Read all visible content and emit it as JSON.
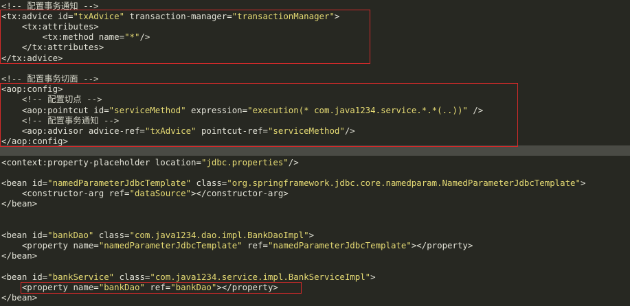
{
  "lines": [
    {
      "segments": [
        {
          "t": "<!-- ",
          "k": "c"
        },
        {
          "t": "配置事务通知",
          "k": "c"
        },
        {
          "t": " -->",
          "k": "c"
        }
      ]
    },
    {
      "segments": [
        {
          "t": "<tx:advice ",
          "k": "tag"
        },
        {
          "t": "id=",
          "k": "attr"
        },
        {
          "t": "\"txAdvice\"",
          "k": "str"
        },
        {
          "t": " transaction-manager=",
          "k": "attr"
        },
        {
          "t": "\"transactionManager\"",
          "k": "str"
        },
        {
          "t": ">",
          "k": "tag"
        }
      ]
    },
    {
      "segments": [
        {
          "t": "    <tx:attributes>",
          "k": "tag"
        }
      ]
    },
    {
      "segments": [
        {
          "t": "        <tx:method ",
          "k": "tag"
        },
        {
          "t": "name=",
          "k": "attr"
        },
        {
          "t": "\"*\"",
          "k": "str"
        },
        {
          "t": "/>",
          "k": "tag"
        }
      ]
    },
    {
      "segments": [
        {
          "t": "    </tx:attributes>",
          "k": "tag"
        }
      ]
    },
    {
      "segments": [
        {
          "t": "</tx:advice>",
          "k": "tag"
        }
      ]
    },
    {
      "segments": []
    },
    {
      "segments": [
        {
          "t": "<!-- ",
          "k": "c"
        },
        {
          "t": "配置事务切面",
          "k": "c"
        },
        {
          "t": " -->",
          "k": "c"
        }
      ]
    },
    {
      "segments": [
        {
          "t": "<aop:config>",
          "k": "tag"
        }
      ]
    },
    {
      "segments": [
        {
          "t": "    <!-- ",
          "k": "c"
        },
        {
          "t": "配置切点",
          "k": "c"
        },
        {
          "t": " -->",
          "k": "c"
        }
      ]
    },
    {
      "segments": [
        {
          "t": "    <aop:pointcut ",
          "k": "tag"
        },
        {
          "t": "id=",
          "k": "attr"
        },
        {
          "t": "\"serviceMethod\"",
          "k": "str"
        },
        {
          "t": " expression=",
          "k": "attr"
        },
        {
          "t": "\"execution(* com.java1234.service.*.*(..))\"",
          "k": "str"
        },
        {
          "t": " />",
          "k": "tag"
        }
      ]
    },
    {
      "segments": [
        {
          "t": "    <!-- ",
          "k": "c"
        },
        {
          "t": "配置事务通知",
          "k": "c"
        },
        {
          "t": " -->",
          "k": "c"
        }
      ]
    },
    {
      "segments": [
        {
          "t": "    <aop:advisor ",
          "k": "tag"
        },
        {
          "t": "advice-ref=",
          "k": "attr"
        },
        {
          "t": "\"txAdvice\"",
          "k": "str"
        },
        {
          "t": " pointcut-ref=",
          "k": "attr"
        },
        {
          "t": "\"serviceMethod\"",
          "k": "str"
        },
        {
          "t": "/>",
          "k": "tag"
        }
      ]
    },
    {
      "segments": [
        {
          "t": "</aop:config>",
          "k": "tag"
        }
      ]
    },
    {
      "segments": []
    },
    {
      "segments": [
        {
          "t": "<context:property-placeholder ",
          "k": "tag"
        },
        {
          "t": "location=",
          "k": "attr"
        },
        {
          "t": "\"jdbc.properties\"",
          "k": "str"
        },
        {
          "t": "/>",
          "k": "tag"
        }
      ]
    },
    {
      "segments": []
    },
    {
      "segments": [
        {
          "t": "<bean ",
          "k": "tag"
        },
        {
          "t": "id=",
          "k": "attr"
        },
        {
          "t": "\"namedParameterJdbcTemplate\"",
          "k": "str"
        },
        {
          "t": " class=",
          "k": "attr"
        },
        {
          "t": "\"org.springframework.jdbc.core.namedparam.NamedParameterJdbcTemplate\"",
          "k": "str"
        },
        {
          "t": ">",
          "k": "tag"
        }
      ]
    },
    {
      "segments": [
        {
          "t": "    <constructor-arg ",
          "k": "tag"
        },
        {
          "t": "ref=",
          "k": "attr"
        },
        {
          "t": "\"dataSource\"",
          "k": "str"
        },
        {
          "t": "></constructor-arg>",
          "k": "tag"
        }
      ]
    },
    {
      "segments": [
        {
          "t": "</bean>",
          "k": "tag"
        }
      ]
    },
    {
      "segments": []
    },
    {
      "segments": []
    },
    {
      "segments": [
        {
          "t": "<bean ",
          "k": "tag"
        },
        {
          "t": "id=",
          "k": "attr"
        },
        {
          "t": "\"bankDao\"",
          "k": "str"
        },
        {
          "t": " class=",
          "k": "attr"
        },
        {
          "t": "\"com.java1234.dao.impl.BankDaoImpl\"",
          "k": "str"
        },
        {
          "t": ">",
          "k": "tag"
        }
      ]
    },
    {
      "segments": [
        {
          "t": "    <property ",
          "k": "tag"
        },
        {
          "t": "name=",
          "k": "attr"
        },
        {
          "t": "\"namedParameterJdbcTemplate\"",
          "k": "str"
        },
        {
          "t": " ref=",
          "k": "attr"
        },
        {
          "t": "\"namedParameterJdbcTemplate\"",
          "k": "str"
        },
        {
          "t": "></property>",
          "k": "tag"
        }
      ]
    },
    {
      "segments": [
        {
          "t": "</bean>",
          "k": "tag"
        }
      ]
    },
    {
      "segments": []
    },
    {
      "segments": [
        {
          "t": "<bean ",
          "k": "tag"
        },
        {
          "t": "id=",
          "k": "attr"
        },
        {
          "t": "\"bankService\"",
          "k": "str"
        },
        {
          "t": " class=",
          "k": "attr"
        },
        {
          "t": "\"com.java1234.service.impl.BankServiceImpl\"",
          "k": "str"
        },
        {
          "t": ">",
          "k": "tag"
        }
      ]
    },
    {
      "segments": [
        {
          "t": "    <property ",
          "k": "tag"
        },
        {
          "t": "name=",
          "k": "attr"
        },
        {
          "t": "\"bankDao\"",
          "k": "str"
        },
        {
          "t": " ref=",
          "k": "attr"
        },
        {
          "t": "\"bankDao\"",
          "k": "str"
        },
        {
          "t": "></property>",
          "k": "tag"
        }
      ]
    },
    {
      "segments": [
        {
          "t": "</bean>",
          "k": "tag"
        }
      ]
    }
  ],
  "colors": {
    "background": "#272822",
    "string": "#e6db74",
    "text": "#e3e3d8",
    "annotation_box": "#d42a2a",
    "current_line": "#4a4b45"
  }
}
